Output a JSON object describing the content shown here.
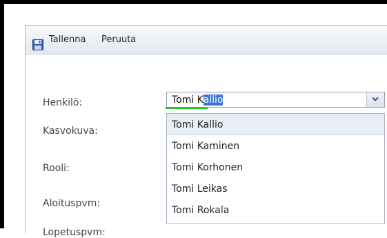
{
  "toolbar": {
    "save_label": "Tallenna",
    "save_icon": "floppy-disk-icon",
    "cancel_label": "Peruuta"
  },
  "form": {
    "labels": [
      "Henkilö:",
      "Kasvokuva:",
      "Rooli:",
      "Aloituspvm:",
      "Lopetuspvm:"
    ],
    "person_combo": {
      "typed": "Tomi K",
      "autocomplete_selected": "allio",
      "dropdown_icon": "chevron-down-icon"
    },
    "dropdown_options": [
      "Tomi Kallio",
      "Tomi Kaminen",
      "Tomi Korhonen",
      "Tomi Leikas",
      "Tomi Rokala"
    ]
  },
  "colors": {
    "selection": "#3875d7",
    "highlight_underline": "#22cc22",
    "active_option_bg": "#e8edf6"
  }
}
